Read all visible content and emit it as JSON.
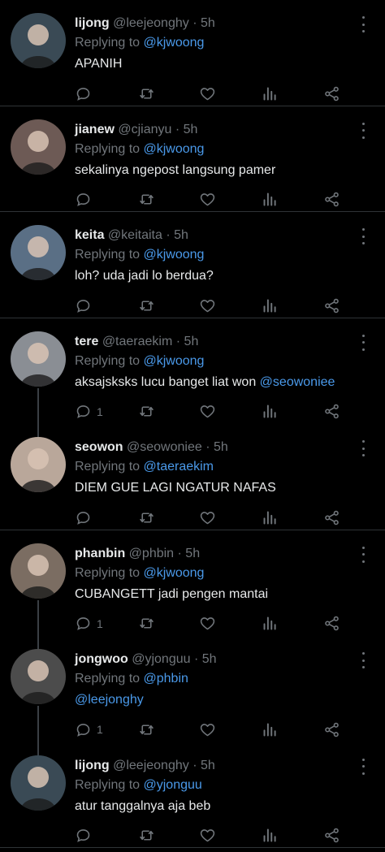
{
  "replying_label": "Replying to",
  "tweets": [
    {
      "name": "lijong",
      "handle": "@leejeonghy",
      "sep": "·",
      "time": "5h",
      "reply_to": "@kjwoong",
      "text_parts": [
        {
          "t": "APANIH",
          "m": false
        }
      ],
      "reply_count": "",
      "threaded": false,
      "avatar": "#3a4a55"
    },
    {
      "name": "jianew",
      "handle": "@cjianyu",
      "sep": "·",
      "time": "5h",
      "reply_to": "@kjwoong",
      "text_parts": [
        {
          "t": "sekalinya ngepost langsung pamer",
          "m": false
        }
      ],
      "reply_count": "",
      "threaded": false,
      "avatar": "#6d5a55"
    },
    {
      "name": "keita",
      "handle": "@keitaita",
      "sep": "·",
      "time": "5h",
      "reply_to": "@kjwoong",
      "text_parts": [
        {
          "t": "loh? uda jadi lo berdua?",
          "m": false
        }
      ],
      "reply_count": "",
      "threaded": false,
      "avatar": "#5a6f85"
    },
    {
      "name": "tere",
      "handle": "@taeraekim",
      "sep": "·",
      "time": "5h",
      "reply_to": "@kjwoong",
      "text_parts": [
        {
          "t": "aksajsksks lucu banget liat won ",
          "m": false
        },
        {
          "t": "@seowoniee",
          "m": true
        }
      ],
      "reply_count": "1",
      "threaded": true,
      "avatar": "#8a8e94"
    },
    {
      "name": "seowon",
      "handle": "@seowoniee",
      "sep": "·",
      "time": "5h",
      "reply_to": "@taeraekim",
      "text_parts": [
        {
          "t": "DIEM GUE LAGI NGATUR NAFAS",
          "m": false
        }
      ],
      "reply_count": "",
      "threaded": false,
      "avatar": "#b9a79a"
    },
    {
      "name": "phanbin",
      "handle": "@phbin",
      "sep": "·",
      "time": "5h",
      "reply_to": "@kjwoong",
      "text_parts": [
        {
          "t": "CUBANGETT jadi pengen mantai",
          "m": false
        }
      ],
      "reply_count": "1",
      "threaded": true,
      "avatar": "#7b6d62"
    },
    {
      "name": "jongwoo",
      "handle": "@yjonguu",
      "sep": "·",
      "time": "5h",
      "reply_to": "@phbin",
      "text_parts": [
        {
          "t": "@leejonghy",
          "m": true
        }
      ],
      "reply_count": "1",
      "threaded": true,
      "avatar": "#4c4c4c"
    },
    {
      "name": "lijong",
      "handle": "@leejeonghy",
      "sep": "·",
      "time": "5h",
      "reply_to": "@yjonguu",
      "text_parts": [
        {
          "t": "atur tanggalnya aja beb",
          "m": false
        }
      ],
      "reply_count": "",
      "threaded": false,
      "avatar": "#3a4a55"
    }
  ]
}
